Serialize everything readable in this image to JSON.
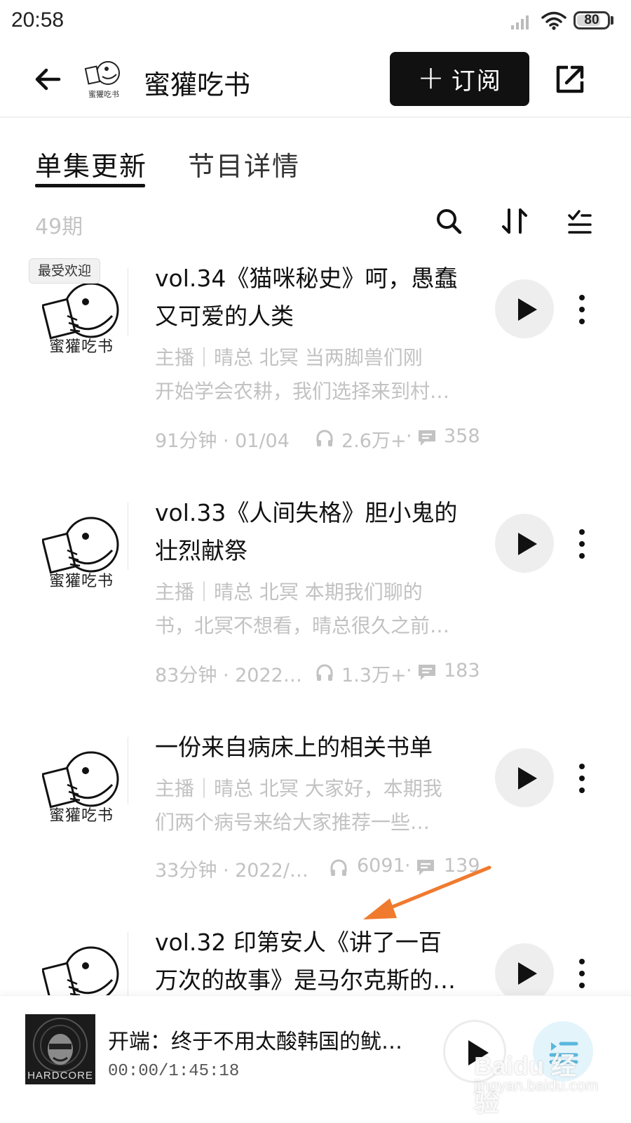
{
  "status_bar": {
    "time": "20:58",
    "battery": "80",
    "battery_percent": 80
  },
  "header": {
    "channel_title": "蜜獾吃书",
    "channel_logo_text": "蜜獾吃书",
    "subscribe_label": "订阅",
    "subscribe_icon": "plus-icon"
  },
  "tabs": [
    {
      "label": "单集更新",
      "active": true
    },
    {
      "label": "节目详情",
      "active": false
    }
  ],
  "episode_list": {
    "count_label": "49期",
    "tools": [
      "search-icon",
      "sort-icon",
      "filter-list-icon"
    ]
  },
  "episodes": [
    {
      "badge": "最受欢迎",
      "thumb_brand": "蜜獾吃书",
      "title_line1": "vol.34《猫咪秘史》呵，愚蠢",
      "title_line2": "又可爱的人类",
      "desc_line1": "主播｜晴总 北冥 当两脚兽们刚",
      "desc_line2": "开始学会农耕，我们选择来到村…",
      "duration_date": "91分钟 · 01/04",
      "plays": "2.6万+",
      "comments": "358"
    },
    {
      "thumb_brand": "蜜獾吃书",
      "title_line1": "vol.33《人间失格》胆小鬼的",
      "title_line2": "壮烈献祭",
      "desc_line1": "主播｜晴总 北冥 本期我们聊的",
      "desc_line2": "书，北冥不想看，晴总很久之前…",
      "duration_date": "83分钟 · 2022…",
      "plays": "1.3万+",
      "comments": "183"
    },
    {
      "thumb_brand": "蜜獾吃书",
      "title_line1": "一份来自病床上的相关书单",
      "desc_line1": "主播｜晴总 北冥 大家好，本期我",
      "desc_line2": "们两个病号来给大家推荐一些…",
      "duration_date": "33分钟 · 2022/…",
      "plays": "6091",
      "comments": "139"
    },
    {
      "title_line1": "vol.32 印第安人《讲了一百",
      "title_line2": "万次的故事》是马尔克斯的…"
    }
  ],
  "mini_player": {
    "title": "开端：终于不用太酸韩国的鱿…",
    "time": "00:00/1:45:18",
    "cover_text": "HARDCORE"
  },
  "watermark": {
    "top": "Baidu 经验",
    "bottom": "jingyan.baidu.com"
  },
  "colors": {
    "accent": "#111111",
    "muted_text": "#c2c2c2",
    "play_bg": "#eeeeee",
    "annotation_arrow": "#f07a2e"
  }
}
